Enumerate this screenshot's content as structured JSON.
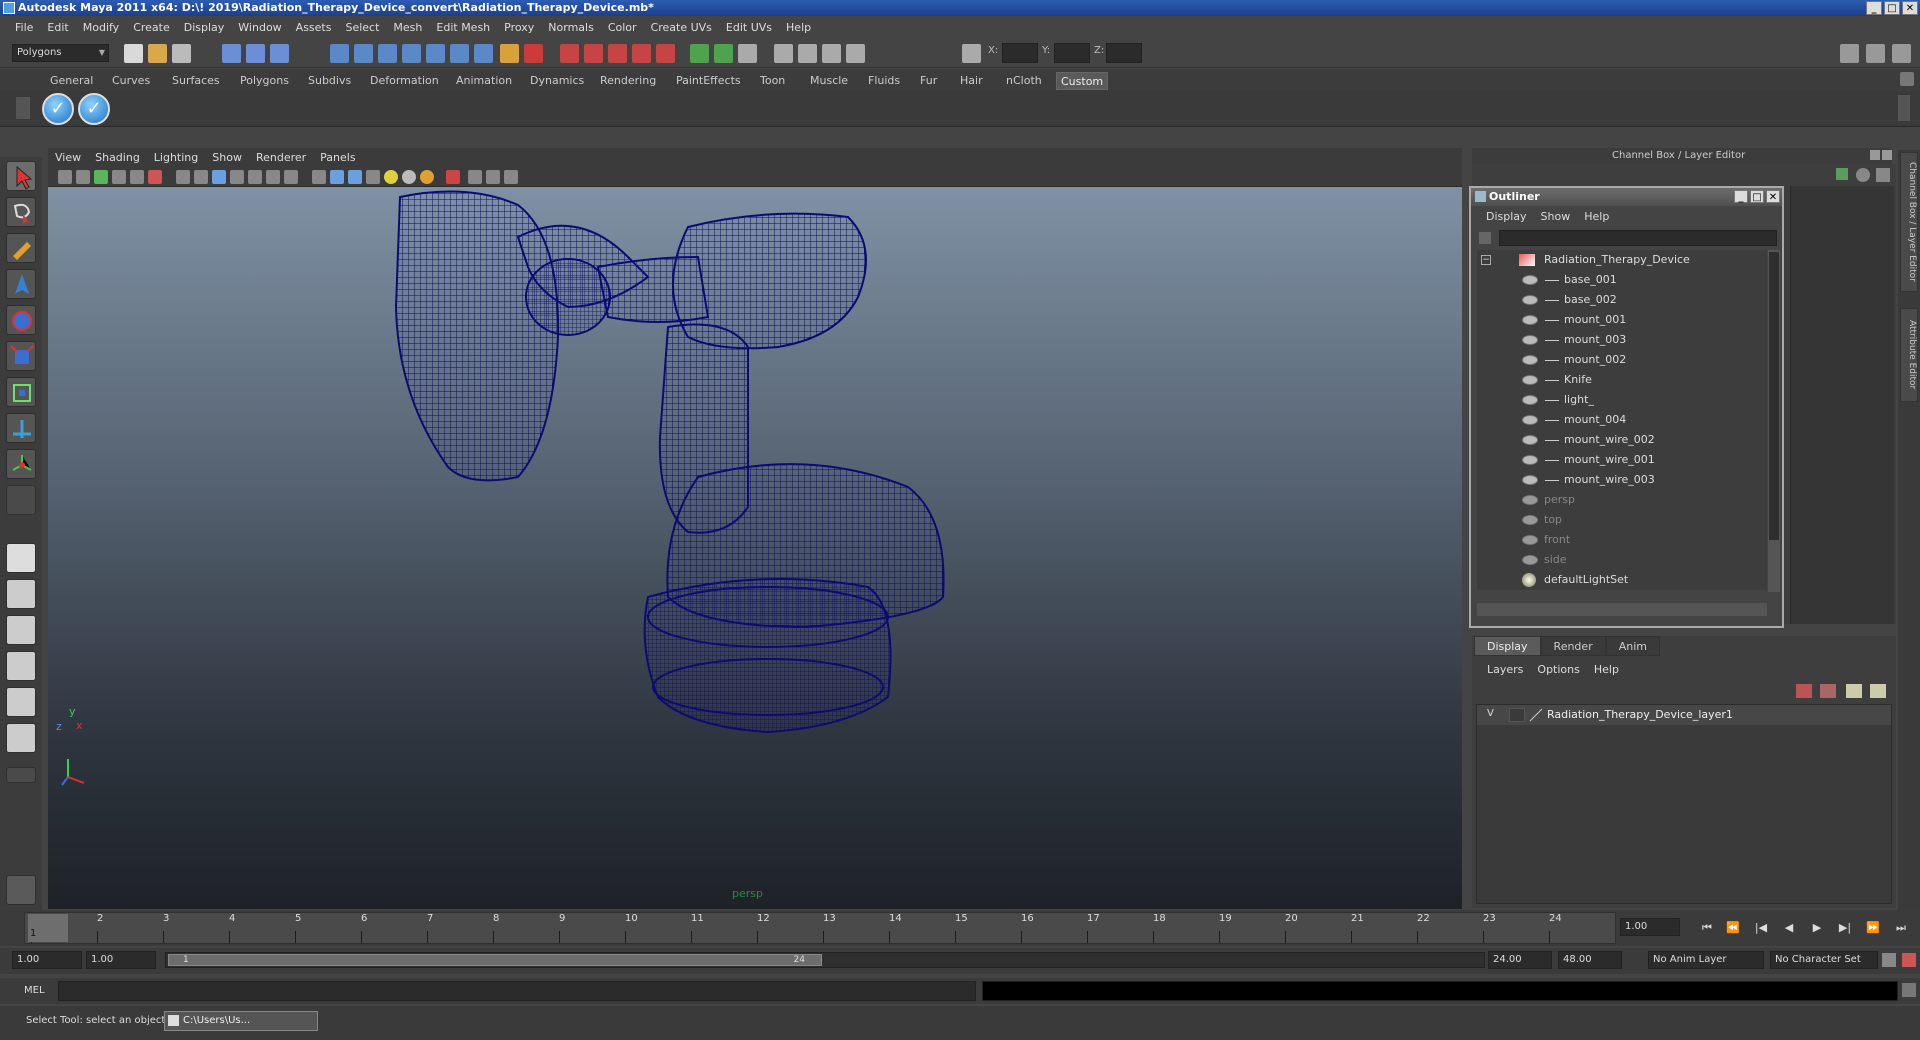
{
  "window": {
    "title": "Autodesk Maya 2011 x64: D:\\! 2019\\Radiation_Therapy_Device_convert\\Radiation_Therapy_Device.mb*",
    "min": "_",
    "max": "□",
    "close": "✕"
  },
  "menu": [
    "File",
    "Edit",
    "Modify",
    "Create",
    "Display",
    "Window",
    "Assets",
    "Select",
    "Mesh",
    "Edit Mesh",
    "Proxy",
    "Normals",
    "Color",
    "Create UVs",
    "Edit UVs",
    "Help"
  ],
  "status": {
    "mode": "Polygons",
    "x_label": "X:",
    "y_label": "Y:",
    "z_label": "Z:"
  },
  "shelf_tabs": [
    "General",
    "Curves",
    "Surfaces",
    "Polygons",
    "Subdivs",
    "Deformation",
    "Animation",
    "Dynamics",
    "Rendering",
    "PaintEffects",
    "Toon",
    "Muscle",
    "Fluids",
    "Fur",
    "Hair",
    "nCloth",
    "Custom"
  ],
  "shelf_active": "Custom",
  "shelf_icon": "✓",
  "viewport": {
    "menu": [
      "View",
      "Shading",
      "Lighting",
      "Show",
      "Renderer",
      "Panels"
    ],
    "camera": "persp",
    "axis_y": "y",
    "axis_x": "x",
    "axis_z": "z",
    "wire_color": "#0b0b72"
  },
  "channel_box": {
    "title": "Channel Box / Layer Editor",
    "tabs": [
      "Channel Box / Layer Editor",
      "Attribute Editor"
    ]
  },
  "outliner": {
    "title": "Outliner",
    "menu": [
      "Display",
      "Show",
      "Help"
    ],
    "root": "Radiation_Therapy_Device",
    "children": [
      "base_001",
      "base_002",
      "mount_001",
      "mount_003",
      "mount_002",
      "Knife",
      "light_",
      "mount_004",
      "mount_wire_002",
      "mount_wire_001",
      "mount_wire_003"
    ],
    "cameras": [
      "persp",
      "top",
      "front",
      "side"
    ],
    "sets": [
      "defaultLightSet"
    ],
    "min": "_",
    "max": "□",
    "close": "✕"
  },
  "layer_editor": {
    "tabs": [
      "Display",
      "Render",
      "Anim"
    ],
    "active_tab": "Display",
    "menu": [
      "Layers",
      "Options",
      "Help"
    ],
    "layers": [
      {
        "visible": "V",
        "name": "Radiation_Therapy_Device_layer1"
      }
    ]
  },
  "timeline": {
    "ticks": [
      "1",
      "2",
      "3",
      "4",
      "5",
      "6",
      "7",
      "8",
      "9",
      "10",
      "11",
      "12",
      "13",
      "14",
      "15",
      "16",
      "17",
      "18",
      "19",
      "20",
      "21",
      "22",
      "23",
      "24"
    ],
    "current": "1",
    "current_field": "1.00"
  },
  "playback": [
    "⏮",
    "⏪",
    "|◀",
    "◀",
    "▶",
    "▶|",
    "⏩",
    "⏭"
  ],
  "range": {
    "start": "1.00",
    "inner_start": "1.00",
    "handle_start": "1",
    "handle_end": "24",
    "end": "24.00",
    "outer_end": "48.00",
    "anim_layer": "No Anim Layer",
    "char_set": "No Character Set"
  },
  "command": {
    "label": "MEL"
  },
  "help_line": {
    "text": "Select Tool: select an object",
    "task": "C:\\Users\\Us..."
  }
}
